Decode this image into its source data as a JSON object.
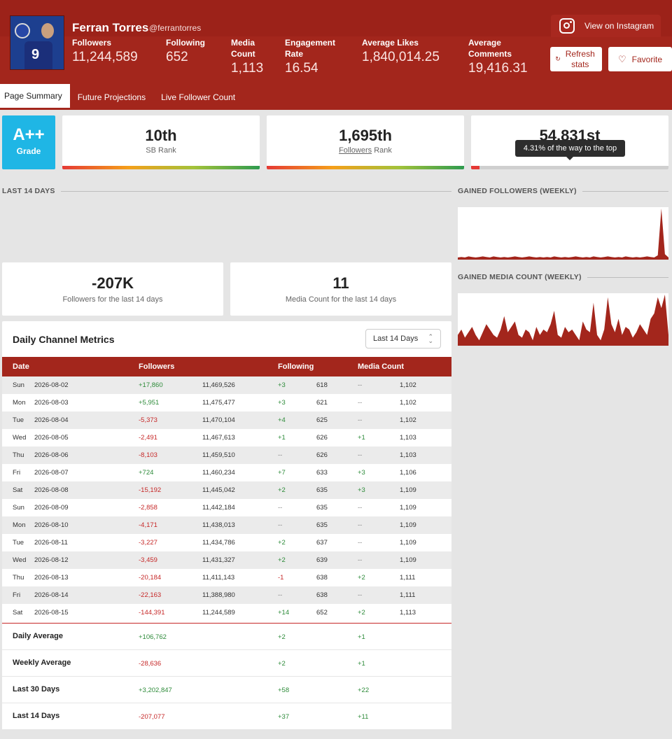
{
  "profile": {
    "name": "Ferran Torres",
    "handle": "@ferrantorres",
    "avatar_number": "9"
  },
  "stats": [
    {
      "label": "Followers",
      "value": "11,244,589"
    },
    {
      "label": "Following",
      "value": "652"
    },
    {
      "label": "Media Count",
      "value": "1,113"
    },
    {
      "label": "Engagement Rate",
      "value": "16.54"
    },
    {
      "label": "Average Likes",
      "value": "1,840,014.25"
    },
    {
      "label": "Average Comments",
      "value": "19,416.31"
    }
  ],
  "buttons": {
    "instagram": "View on Instagram",
    "refresh": "Refresh stats",
    "favorite": "Favorite"
  },
  "tabs": [
    "Page Summary",
    "Future Projections",
    "Live Follower Count"
  ],
  "grade": {
    "value": "A++",
    "label": "Grade"
  },
  "ranks": [
    {
      "value": "10th",
      "label": "SB Rank"
    },
    {
      "value": "1,695th",
      "label_link": "Followers",
      "label_rest": " Rank"
    },
    {
      "value": "54,831st",
      "progress_percent": 4.31
    }
  ],
  "tooltip": "4.31% of the way to the top",
  "sections": {
    "last14": "LAST 14 DAYS",
    "gained_followers": "GAINED FOLLOWERS (WEEKLY)",
    "gained_media": "GAINED MEDIA COUNT (WEEKLY)"
  },
  "summary": [
    {
      "value": "-207K",
      "label": "Followers for the last 14 days"
    },
    {
      "value": "11",
      "label": "Media Count for the last 14 days"
    }
  ],
  "chart_data": [
    {
      "type": "area",
      "title": "GAINED FOLLOWERS (WEEKLY)",
      "color": "#a3261c",
      "values": [
        4,
        5,
        4,
        6,
        5,
        4,
        5,
        6,
        5,
        4,
        6,
        5,
        4,
        5,
        4,
        5,
        6,
        5,
        4,
        5,
        6,
        5,
        4,
        5,
        4,
        5,
        4,
        6,
        5,
        4,
        5,
        4,
        5,
        6,
        5,
        4,
        5,
        4,
        6,
        5,
        4,
        5,
        6,
        5,
        4,
        5,
        4,
        6,
        5,
        4,
        5,
        4,
        5,
        6,
        5,
        4,
        8,
        95,
        10,
        4
      ]
    },
    {
      "type": "area",
      "title": "GAINED MEDIA COUNT (WEEKLY)",
      "color": "#a3261c",
      "values": [
        20,
        30,
        15,
        25,
        35,
        20,
        10,
        25,
        40,
        30,
        20,
        15,
        30,
        55,
        25,
        35,
        45,
        20,
        15,
        30,
        25,
        10,
        35,
        20,
        30,
        25,
        40,
        65,
        20,
        15,
        35,
        25,
        30,
        20,
        10,
        45,
        30,
        25,
        80,
        20,
        10,
        30,
        90,
        40,
        25,
        50,
        20,
        35,
        30,
        15,
        25,
        40,
        30,
        20,
        50,
        60,
        90,
        70,
        95,
        20
      ]
    }
  ],
  "table": {
    "title": "Daily Channel Metrics",
    "range_select": "Last 14 Days",
    "headers": {
      "date": "Date",
      "followers": "Followers",
      "following": "Following",
      "media": "Media Count"
    },
    "rows": [
      {
        "day": "Sun",
        "date": "2026-08-02",
        "f_delta": "+17,860",
        "f_total": "11,469,526",
        "fw_delta": "+3",
        "fw_total": "618",
        "m_delta": "--",
        "m_total": "1,102"
      },
      {
        "day": "Mon",
        "date": "2026-08-03",
        "f_delta": "+5,951",
        "f_total": "11,475,477",
        "fw_delta": "+3",
        "fw_total": "621",
        "m_delta": "--",
        "m_total": "1,102"
      },
      {
        "day": "Tue",
        "date": "2026-08-04",
        "f_delta": "-5,373",
        "f_total": "11,470,104",
        "fw_delta": "+4",
        "fw_total": "625",
        "m_delta": "--",
        "m_total": "1,102"
      },
      {
        "day": "Wed",
        "date": "2026-08-05",
        "f_delta": "-2,491",
        "f_total": "11,467,613",
        "fw_delta": "+1",
        "fw_total": "626",
        "m_delta": "+1",
        "m_total": "1,103"
      },
      {
        "day": "Thu",
        "date": "2026-08-06",
        "f_delta": "-8,103",
        "f_total": "11,459,510",
        "fw_delta": "--",
        "fw_total": "626",
        "m_delta": "--",
        "m_total": "1,103"
      },
      {
        "day": "Fri",
        "date": "2026-08-07",
        "f_delta": "+724",
        "f_total": "11,460,234",
        "fw_delta": "+7",
        "fw_total": "633",
        "m_delta": "+3",
        "m_total": "1,106"
      },
      {
        "day": "Sat",
        "date": "2026-08-08",
        "f_delta": "-15,192",
        "f_total": "11,445,042",
        "fw_delta": "+2",
        "fw_total": "635",
        "m_delta": "+3",
        "m_total": "1,109"
      },
      {
        "day": "Sun",
        "date": "2026-08-09",
        "f_delta": "-2,858",
        "f_total": "11,442,184",
        "fw_delta": "--",
        "fw_total": "635",
        "m_delta": "--",
        "m_total": "1,109"
      },
      {
        "day": "Mon",
        "date": "2026-08-10",
        "f_delta": "-4,171",
        "f_total": "11,438,013",
        "fw_delta": "--",
        "fw_total": "635",
        "m_delta": "--",
        "m_total": "1,109"
      },
      {
        "day": "Tue",
        "date": "2026-08-11",
        "f_delta": "-3,227",
        "f_total": "11,434,786",
        "fw_delta": "+2",
        "fw_total": "637",
        "m_delta": "--",
        "m_total": "1,109"
      },
      {
        "day": "Wed",
        "date": "2026-08-12",
        "f_delta": "-3,459",
        "f_total": "11,431,327",
        "fw_delta": "+2",
        "fw_total": "639",
        "m_delta": "--",
        "m_total": "1,109"
      },
      {
        "day": "Thu",
        "date": "2026-08-13",
        "f_delta": "-20,184",
        "f_total": "11,411,143",
        "fw_delta": "-1",
        "fw_total": "638",
        "m_delta": "+2",
        "m_total": "1,111"
      },
      {
        "day": "Fri",
        "date": "2026-08-14",
        "f_delta": "-22,163",
        "f_total": "11,388,980",
        "fw_delta": "--",
        "fw_total": "638",
        "m_delta": "--",
        "m_total": "1,111"
      },
      {
        "day": "Sat",
        "date": "2026-08-15",
        "f_delta": "-144,391",
        "f_total": "11,244,589",
        "fw_delta": "+14",
        "fw_total": "652",
        "m_delta": "+2",
        "m_total": "1,113"
      }
    ],
    "footer": [
      {
        "label": "Daily Average",
        "f": "+106,762",
        "fw": "+2",
        "m": "+1"
      },
      {
        "label": "Weekly Average",
        "f": "-28,636",
        "fw": "+2",
        "m": "+1"
      },
      {
        "label": "Last 30 Days",
        "f": "+3,202,847",
        "fw": "+58",
        "m": "+22"
      },
      {
        "label": "Last 14 Days",
        "f": "-207,077",
        "fw": "+37",
        "m": "+11"
      }
    ]
  }
}
